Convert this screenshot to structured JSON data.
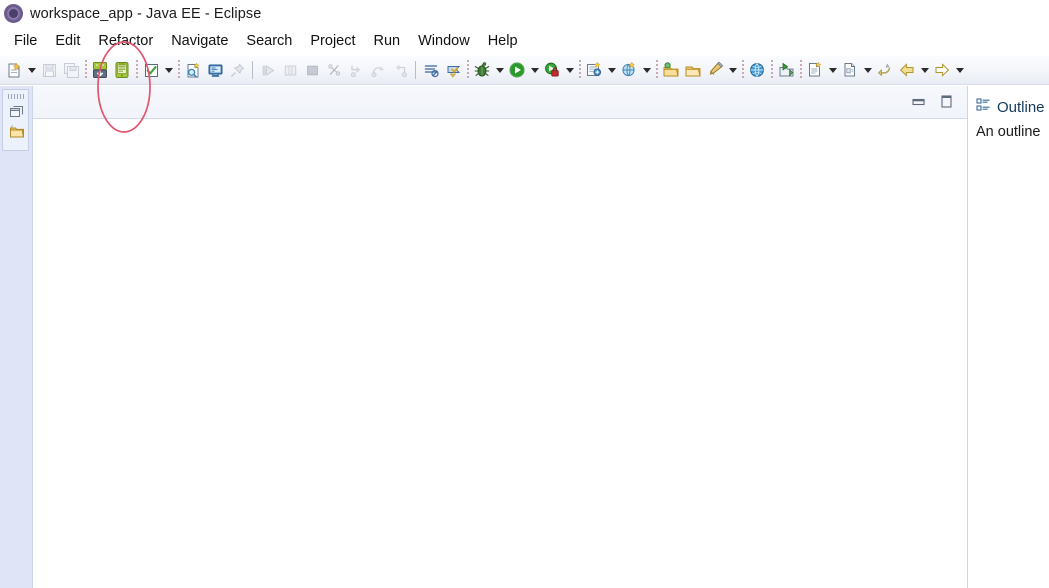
{
  "window": {
    "title": "workspace_app - Java EE - Eclipse",
    "app_icon": "eclipse-logo-icon"
  },
  "menubar": {
    "items": [
      {
        "label": "File",
        "name": "menu-file"
      },
      {
        "label": "Edit",
        "name": "menu-edit"
      },
      {
        "label": "Refactor",
        "name": "menu-refactor"
      },
      {
        "label": "Navigate",
        "name": "menu-navigate"
      },
      {
        "label": "Search",
        "name": "menu-search"
      },
      {
        "label": "Project",
        "name": "menu-project"
      },
      {
        "label": "Run",
        "name": "menu-run"
      },
      {
        "label": "Window",
        "name": "menu-window"
      },
      {
        "label": "Help",
        "name": "menu-help"
      }
    ]
  },
  "toolbar": {
    "items": [
      {
        "type": "button",
        "icon": "new-wizard-icon",
        "tooltip": "New"
      },
      {
        "type": "arrow",
        "icon": "chevron-down-icon",
        "tooltip": "New options"
      },
      {
        "type": "button",
        "icon": "save-icon",
        "tooltip": "Save",
        "disabled": true
      },
      {
        "type": "button",
        "icon": "save-all-icon",
        "tooltip": "Save All",
        "disabled": true
      },
      {
        "type": "sep",
        "icon": "separator-dotted"
      },
      {
        "type": "button",
        "icon": "android-sdk-manager-icon",
        "tooltip": "Android SDK Manager"
      },
      {
        "type": "button",
        "icon": "android-avd-manager-icon",
        "tooltip": "Android Virtual Device Manager"
      },
      {
        "type": "sep",
        "icon": "separator-dotted"
      },
      {
        "type": "button",
        "icon": "checkmark-build-icon",
        "tooltip": "Build"
      },
      {
        "type": "arrow",
        "icon": "chevron-down-icon",
        "tooltip": "Build options"
      },
      {
        "type": "sep",
        "icon": "separator-dotted"
      },
      {
        "type": "button",
        "icon": "quick-access-search-icon",
        "tooltip": "Open Task"
      },
      {
        "type": "button",
        "icon": "console-icon",
        "tooltip": "Open Console"
      },
      {
        "type": "button",
        "icon": "pin-icon",
        "tooltip": "Pin",
        "disabled": true
      },
      {
        "type": "bigsep",
        "icon": "separator-line"
      },
      {
        "type": "button",
        "icon": "resume-icon",
        "tooltip": "Resume",
        "disabled": true
      },
      {
        "type": "button",
        "icon": "suspend-icon",
        "tooltip": "Suspend",
        "disabled": true
      },
      {
        "type": "button",
        "icon": "terminate-icon",
        "tooltip": "Terminate",
        "disabled": true
      },
      {
        "type": "button",
        "icon": "disconnect-icon",
        "tooltip": "Disconnect",
        "disabled": true
      },
      {
        "type": "button",
        "icon": "step-into-icon",
        "tooltip": "Step Into",
        "disabled": true
      },
      {
        "type": "button",
        "icon": "step-over-icon",
        "tooltip": "Step Over",
        "disabled": true
      },
      {
        "type": "button",
        "icon": "step-return-icon",
        "tooltip": "Step Return",
        "disabled": true
      },
      {
        "type": "bigsep",
        "icon": "separator-line"
      },
      {
        "type": "button",
        "icon": "skip-breakpoints-icon",
        "tooltip": "Skip All Breakpoints"
      },
      {
        "type": "button",
        "icon": "next-annotation-icon",
        "tooltip": "Next Annotation"
      },
      {
        "type": "sep",
        "icon": "separator-dotted"
      },
      {
        "type": "button",
        "icon": "debug-bug-icon",
        "tooltip": "Debug"
      },
      {
        "type": "arrow",
        "icon": "chevron-down-icon",
        "tooltip": "Debug configurations"
      },
      {
        "type": "button",
        "icon": "run-green-icon",
        "tooltip": "Run"
      },
      {
        "type": "arrow",
        "icon": "chevron-down-icon",
        "tooltip": "Run configurations"
      },
      {
        "type": "button",
        "icon": "profile-icon",
        "tooltip": "Profile"
      },
      {
        "type": "arrow",
        "icon": "chevron-down-icon",
        "tooltip": "Profile configurations"
      },
      {
        "type": "sep",
        "icon": "separator-dotted"
      },
      {
        "type": "button",
        "icon": "new-java-project-icon",
        "tooltip": "New Java Project"
      },
      {
        "type": "arrow",
        "icon": "chevron-down-icon",
        "tooltip": "New project options"
      },
      {
        "type": "button",
        "icon": "new-servlet-icon",
        "tooltip": "New Servlet"
      },
      {
        "type": "arrow",
        "icon": "chevron-down-icon",
        "tooltip": "New servlet options"
      },
      {
        "type": "sep",
        "icon": "separator-dotted"
      },
      {
        "type": "button",
        "icon": "open-type-icon",
        "tooltip": "Open Type"
      },
      {
        "type": "button",
        "icon": "open-task-icon",
        "tooltip": "Open Task"
      },
      {
        "type": "button",
        "icon": "search-icon",
        "tooltip": "Search"
      },
      {
        "type": "arrow",
        "icon": "chevron-down-icon",
        "tooltip": "Search options"
      },
      {
        "type": "sep",
        "icon": "separator-dotted"
      },
      {
        "type": "button",
        "icon": "web-browser-icon",
        "tooltip": "Open Web Browser"
      },
      {
        "type": "sep",
        "icon": "separator-dotted"
      },
      {
        "type": "button",
        "icon": "run-last-tool-icon",
        "tooltip": "Run Last Tool"
      },
      {
        "type": "sep",
        "icon": "separator-dotted"
      },
      {
        "type": "button",
        "icon": "new-jsp-icon",
        "tooltip": "New JSP File"
      },
      {
        "type": "arrow",
        "icon": "chevron-down-icon",
        "tooltip": "New JSP options"
      },
      {
        "type": "button",
        "icon": "new-html-icon",
        "tooltip": "New HTML File"
      },
      {
        "type": "arrow",
        "icon": "chevron-down-icon",
        "tooltip": "New HTML options"
      },
      {
        "type": "button",
        "icon": "previous-edit-icon",
        "tooltip": "Previous Edit Location"
      },
      {
        "type": "button",
        "icon": "back-arrow-icon",
        "tooltip": "Back"
      },
      {
        "type": "arrow",
        "icon": "chevron-down-icon",
        "tooltip": "Back history"
      },
      {
        "type": "button",
        "icon": "forward-arrow-icon",
        "tooltip": "Forward"
      },
      {
        "type": "arrow",
        "icon": "chevron-down-icon",
        "tooltip": "Forward history"
      }
    ]
  },
  "left_view_bar": {
    "restore_icon": "restore-view-icon",
    "explorer_icon": "package-explorer-icon"
  },
  "editor": {
    "minimize_icon": "minimize-icon",
    "maximize_icon": "maximize-icon",
    "open_tabs": []
  },
  "outline": {
    "icon": "outline-view-icon",
    "tab_label": "Outline",
    "body_text": "An outline"
  },
  "annotation": {
    "shape": "ellipse",
    "color": "#e0566e",
    "targets": [
      "android-sdk-manager-icon",
      "android-avd-manager-icon"
    ]
  }
}
